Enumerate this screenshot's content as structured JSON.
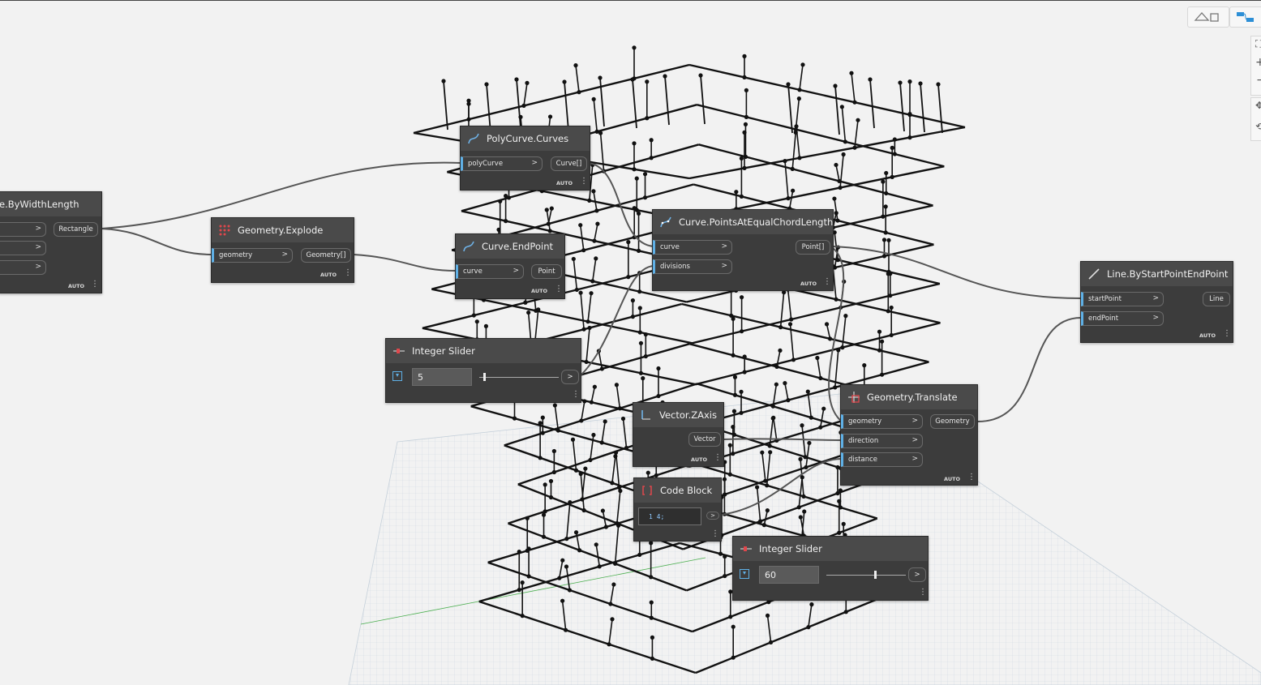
{
  "nodes": {
    "rectangle": {
      "title": "e.ByWidthLength",
      "output": "Rectangle",
      "auto": "AUTO"
    },
    "explode": {
      "title": "Geometry.Explode",
      "input": "geometry",
      "output": "Geometry[]",
      "auto": "AUTO"
    },
    "polycurve": {
      "title": "PolyCurve.Curves",
      "input": "polyCurve",
      "output": "Curve[]",
      "auto": "AUTO"
    },
    "endpoint": {
      "title": "Curve.EndPoint",
      "input": "curve",
      "output": "Point",
      "auto": "AUTO"
    },
    "chord": {
      "title": "Curve.PointsAtEqualChordLength",
      "inputs": [
        "curve",
        "divisions"
      ],
      "output": "Point[]",
      "auto": "AUTO"
    },
    "line": {
      "title": "Line.ByStartPointEndPoint",
      "inputs": [
        "startPoint",
        "endPoint"
      ],
      "output": "Line",
      "auto": "AUTO"
    },
    "slider1": {
      "title": "Integer Slider",
      "value": "5",
      "level": 0.05
    },
    "zaxis": {
      "title": "Vector.ZAxis",
      "output": "Vector",
      "auto": "AUTO"
    },
    "translate": {
      "title": "Geometry.Translate",
      "inputs": [
        "geometry",
        "direction",
        "distance"
      ],
      "output": "Geometry",
      "auto": "AUTO"
    },
    "codeblock": {
      "title": "Code Block",
      "code": "1 4;"
    },
    "slider2": {
      "title": "Integer Slider",
      "value": "60",
      "level": 0.6
    }
  },
  "colors": {
    "port_accent": "#5fb0e6",
    "node_bg": "#3c3c3c",
    "header_bg": "#4a4a4a",
    "canvas": "#f2f2f2"
  },
  "icons": [
    "geometry-view-icon",
    "graph-view-icon",
    "zoom-to-fit-icon",
    "zoom-in-icon",
    "zoom-out-icon",
    "pan-icon",
    "orbit-icon"
  ]
}
